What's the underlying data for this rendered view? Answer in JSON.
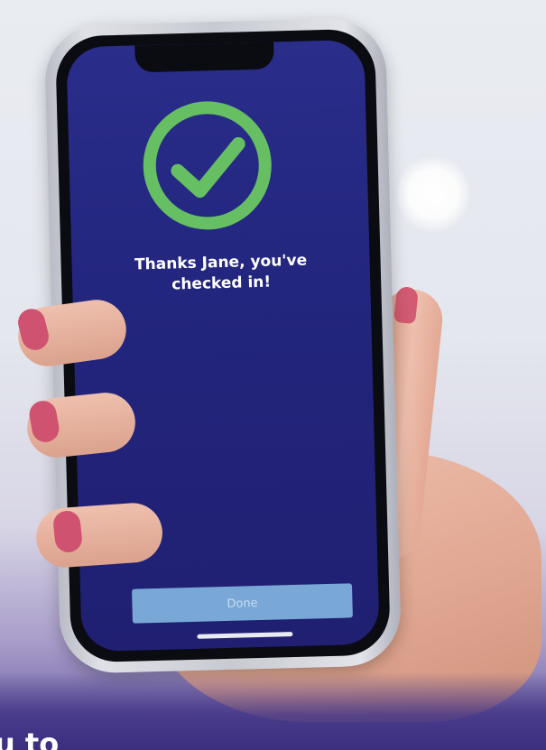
{
  "screen": {
    "confirmation_line_1": "Thanks Jane, you've",
    "confirmation_line_2": "checked in!",
    "done_label": "Done"
  },
  "overlay_text": "u to",
  "icons": {
    "check": "check-circle-icon"
  },
  "colors": {
    "screen_bg": "#23267e",
    "check_green": "#66bf63",
    "done_button": "#7aa8d6"
  }
}
